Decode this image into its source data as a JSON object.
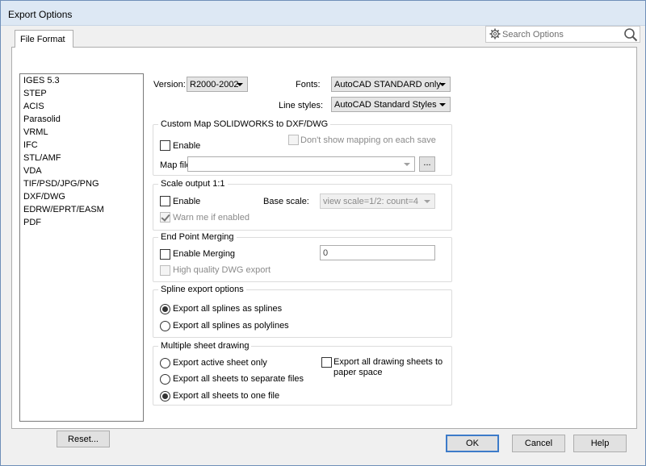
{
  "window": {
    "title": "Export Options"
  },
  "tabs": [
    {
      "label": "File Format"
    }
  ],
  "search": {
    "placeholder": "Search Options"
  },
  "formats": [
    "IGES 5.3",
    "STEP",
    "ACIS",
    "Parasolid",
    "VRML",
    "IFC",
    "STL/AMF",
    "VDA",
    "TIF/PSD/JPG/PNG",
    "DXF/DWG",
    "EDRW/EPRT/EASM",
    "PDF"
  ],
  "reset_label": "Reset...",
  "version": {
    "label": "Version:",
    "value": "R2000-2002"
  },
  "fonts": {
    "label": "Fonts:",
    "value": "AutoCAD STANDARD only"
  },
  "line_styles": {
    "label": "Line styles:",
    "value": "AutoCAD Standard Styles"
  },
  "custom_map": {
    "title": "Custom Map SOLIDWORKS to DXF/DWG",
    "enable": "Enable",
    "dont_show": "Don't show mapping on each save",
    "map_file": "Map file:",
    "browse": "..."
  },
  "scale": {
    "title": "Scale output 1:1",
    "enable": "Enable",
    "base_scale_label": "Base scale:",
    "base_scale_value": "view scale=1/2: count=4",
    "warn": "Warn me if enabled"
  },
  "endpoint": {
    "title": "End Point Merging",
    "enable": "Enable Merging",
    "value": "0",
    "hq": "High quality DWG export"
  },
  "spline": {
    "title": "Spline export options",
    "opt1": "Export all splines as splines",
    "opt2": "Export all splines as polylines"
  },
  "sheets": {
    "title": "Multiple sheet drawing",
    "opt1": "Export active sheet only",
    "opt2": "Export all sheets to separate files",
    "opt3": "Export all sheets to one file",
    "paper_line1": "Export all drawing sheets to",
    "paper_line2": "paper space"
  },
  "buttons": {
    "ok": "OK",
    "cancel": "Cancel",
    "help": "Help"
  }
}
